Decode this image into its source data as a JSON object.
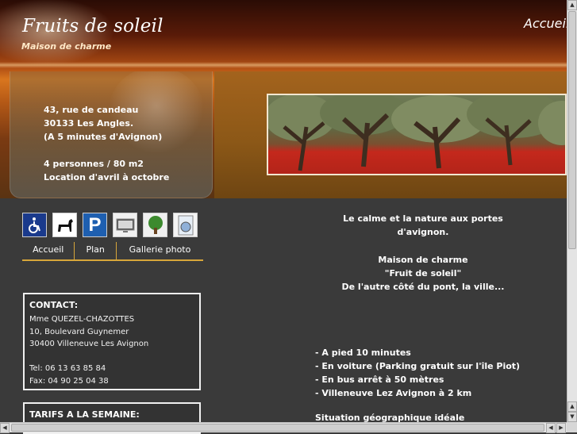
{
  "header": {
    "title": "Fruits de soleil",
    "subtitle": "Maison de charme",
    "nav_accueil": "Accueil"
  },
  "info": {
    "lines": [
      "43, rue de candeau",
      "30133 Les Angles.",
      "(A 5 minutes d'Avignon)",
      "",
      "4 personnes / 80 m2",
      "Location d'avril à octobre"
    ]
  },
  "icons": [
    "wheelchair-icon",
    "dog-icon",
    "parking-icon",
    "tv-icon",
    "tree-icon",
    "washing-machine-icon"
  ],
  "subnav": {
    "accueil": "Accueil",
    "plan": "Plan",
    "gallerie": "Gallerie photo"
  },
  "contact": {
    "heading": "CONTACT:",
    "name": "Mme QUEZEL-CHAZOTTES",
    "street": "10, Boulevard Guynemer",
    "city": "30400 Villeneuve Les Avignon",
    "tel": "Tel: 06 13 63 85 84",
    "fax": "Fax: 04 90 25 04 38"
  },
  "tarifs": {
    "heading": "TARIFS A LA SEMAINE:"
  },
  "description": {
    "line1": "Le calme et la nature aux portes",
    "line2": "d'avignon.",
    "line3": "Maison de charme",
    "line4": "\"Fruit de soleil\"",
    "line5": "De l'autre côté du pont, la ville..."
  },
  "access": [
    "- A pied 10 minutes",
    "- En voiture (Parking gratuit sur l'île Piot)",
    "- En bus arrêt à 50 mètres",
    "- Villeneuve Lez Avignon à 2 km"
  ],
  "cutoff_heading": "Situation géographique idéale"
}
